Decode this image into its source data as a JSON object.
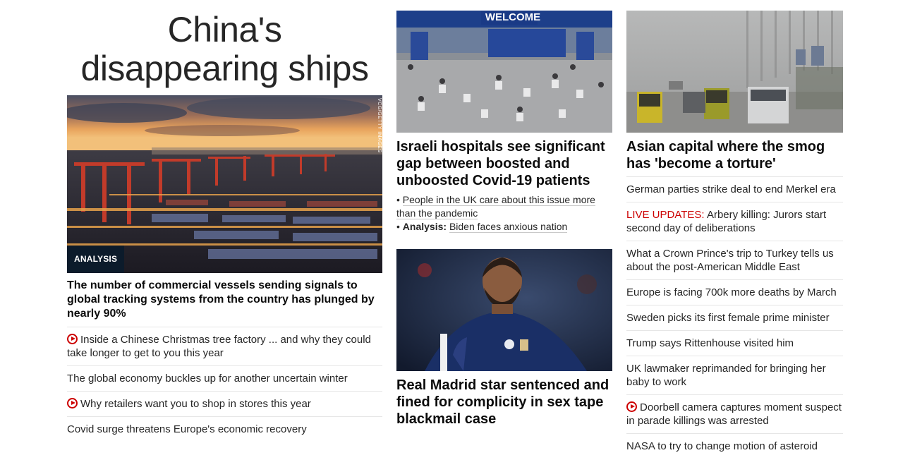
{
  "lead": {
    "title": "China's disappearing ships",
    "badge": "ANALYSIS",
    "credit": "VCG/GETTY IMAGES",
    "description": "The number of commercial vessels sending signals to global tracking systems from the country has plunged by nearly 90%",
    "links": [
      {
        "text": "Inside a Chinese Christmas tree factory ... and why they could take longer to get to you this year",
        "video": true
      },
      {
        "text": "The global economy buckles up for another uncertain winter",
        "video": false
      },
      {
        "text": "Why retailers want you to shop in stores this year",
        "video": true
      },
      {
        "text": "Covid surge threatens Europe's economic recovery",
        "video": false
      }
    ]
  },
  "middle": {
    "card1": {
      "image_sign": "WELCOME",
      "title": "Israeli hospitals see significant gap between boosted and unboosted Covid-19 patients",
      "sub1": "People in the UK care about this issue more than the pandemic",
      "sub2_label": "Analysis:",
      "sub2_text": "Biden faces anxious nation"
    },
    "card2": {
      "title": "Real Madrid star sentenced and fined for complicity in sex tape blackmail case"
    }
  },
  "right": {
    "card": {
      "title": "Asian capital where the smog has 'become a torture'"
    },
    "links": [
      {
        "text": "German parties strike deal to end Merkel era"
      },
      {
        "live": "LIVE UPDATES:",
        "text": "Arbery killing: Jurors start second day of deliberations"
      },
      {
        "text": "What a Crown Prince's trip to Turkey tells us about the post-American Middle East"
      },
      {
        "text": "Europe is facing 700k more deaths by March"
      },
      {
        "text": "Sweden picks its first female prime minister"
      },
      {
        "text": "Trump says Rittenhouse visited him"
      },
      {
        "text": "UK lawmaker reprimanded for bringing her baby to work"
      },
      {
        "text": "Doorbell camera captures moment suspect in parade killings was arrested",
        "video": true
      },
      {
        "text": "NASA to try to change motion of asteroid"
      }
    ]
  },
  "colors": {
    "accent": "#cc0000",
    "badge_bg": "#0c1b2b",
    "text": "#0c0c0c"
  }
}
